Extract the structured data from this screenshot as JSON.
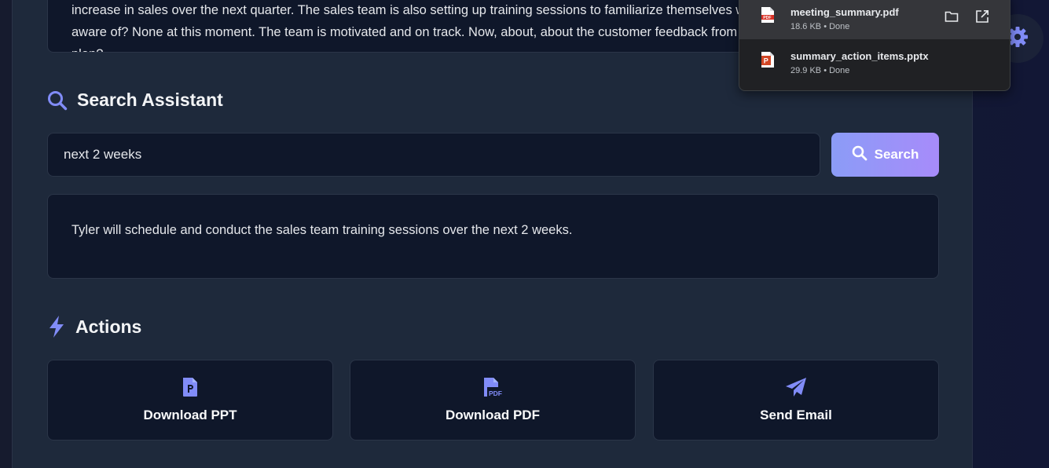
{
  "transcript": {
    "text": "increase in sales over the next quarter. The sales team is also setting up training sessions to familiarize themselves with the new features. Excellent. Any concerns or obstacles we should be aware of? None at this moment. The team is motivated and on track. Now, about, about the customer feedback from the beta testers. Nancy, have you incorporated their suggestions into the plan?"
  },
  "search": {
    "title": "Search Assistant",
    "input_value": "next 2 weeks",
    "button_label": "Search",
    "result": "Tyler will schedule and conduct the sales team training sessions over the next 2 weeks."
  },
  "actions": {
    "title": "Actions",
    "items": [
      {
        "label": "Download PPT",
        "icon": "file-ppt-icon"
      },
      {
        "label": "Download PDF",
        "icon": "file-pdf-icon"
      },
      {
        "label": "Send Email",
        "icon": "paper-plane-icon"
      }
    ]
  },
  "downloads": {
    "items": [
      {
        "name": "meeting_summary.pdf",
        "meta": "18.6 KB • Done",
        "type_label": "PDF"
      },
      {
        "name": "summary_action_items.pptx",
        "meta": "29.9 KB • Done",
        "type_label": "P"
      }
    ]
  },
  "colors": {
    "accent": "#818cf8",
    "button_gradient_start": "#8b9cf7",
    "button_gradient_end": "#a78bfa",
    "panel_bg": "#1e293b",
    "box_bg": "#0f172a"
  }
}
